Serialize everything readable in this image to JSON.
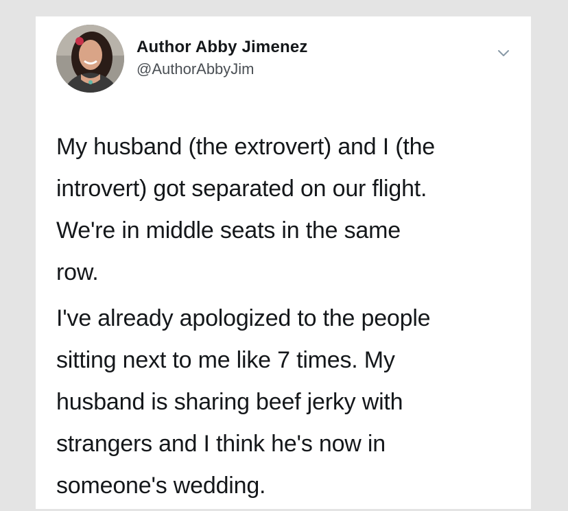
{
  "tweet": {
    "author": {
      "display_name": "Author Abby Jimenez",
      "handle": "@AuthorAbbyJim",
      "avatar_icon": "profile-photo"
    },
    "menu_icon": "chevron-down-icon",
    "paragraphs": [
      {
        "lines": [
          "My husband (the extrovert) and I (the",
          "introvert) got separated on our flight.",
          "We're in middle seats in the same",
          "row."
        ]
      },
      {
        "lines": [
          "I've already apologized to the people",
          "sitting next to me like 7 times. My",
          "husband is sharing beef jerky with",
          "strangers and I think he's now in",
          "someone's wedding."
        ]
      }
    ]
  },
  "colors": {
    "background": "#e4e4e4",
    "card": "#ffffff",
    "text": "#14171a",
    "secondary_text": "#4a4f54",
    "chevron": "#8899a6"
  }
}
